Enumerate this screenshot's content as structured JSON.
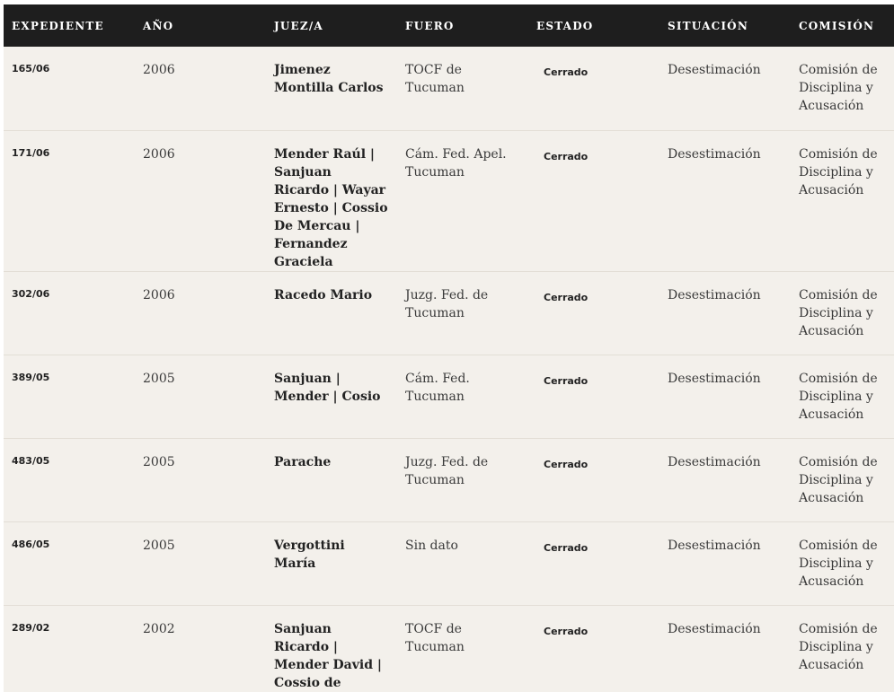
{
  "table": {
    "headers": [
      "EXPEDIENTE",
      "AÑO",
      "JUEZ/A",
      "FUERO",
      "ESTADO",
      "SITUACIÓN",
      "COMISIÓN"
    ],
    "rows": [
      {
        "expediente": "165/06",
        "anio": "2006",
        "juez": "Jimenez Montilla Carlos",
        "fuero": "TOCF de Tucuman",
        "estado": "Cerrado",
        "situacion": "Desestimación",
        "comision": "Comisión de Disciplina y Acusación"
      },
      {
        "expediente": "171/06",
        "anio": "2006",
        "juez": "Mender Raúl | Sanjuan Ricardo | Wayar Ernesto | Cossio De Mercau | Fernandez Graciela",
        "fuero": "Cám. Fed. Apel. Tucuman",
        "estado": "Cerrado",
        "situacion": "Desestimación",
        "comision": "Comisión de Disciplina y Acusación"
      },
      {
        "expediente": "302/06",
        "anio": "2006",
        "juez": "Racedo Mario",
        "fuero": "Juzg. Fed. de Tucuman",
        "estado": "Cerrado",
        "situacion": "Desestimación",
        "comision": "Comisión de Disciplina y Acusación"
      },
      {
        "expediente": "389/05",
        "anio": "2005",
        "juez": "Sanjuan | Mender | Cosio",
        "fuero": "Cám. Fed. Tucuman",
        "estado": "Cerrado",
        "situacion": "Desestimación",
        "comision": "Comisión de Disciplina y Acusación"
      },
      {
        "expediente": "483/05",
        "anio": "2005",
        "juez": "Parache",
        "fuero": "Juzg. Fed. de Tucuman",
        "estado": "Cerrado",
        "situacion": "Desestimación",
        "comision": "Comisión de Disciplina y Acusación"
      },
      {
        "expediente": "486/05",
        "anio": "2005",
        "juez": "Vergottini María",
        "fuero": "Sin dato",
        "estado": "Cerrado",
        "situacion": "Desestimación",
        "comision": "Comisión de Disciplina y Acusación"
      },
      {
        "expediente": "289/02",
        "anio": "2002",
        "juez": "Sanjuan Ricardo | Mender David | Cossio de Mercau Marina",
        "fuero": "TOCF de Tucuman",
        "estado": "Cerrado",
        "situacion": "Desestimación",
        "comision": "Comisión de Disciplina y Acusación"
      }
    ]
  },
  "colors": {
    "header_bg": "#1e1e1e",
    "header_text": "#ffffff",
    "row_bg": "#f3f0eb",
    "row_divider": "#e3ded6",
    "body_text": "#3a3a3a"
  }
}
